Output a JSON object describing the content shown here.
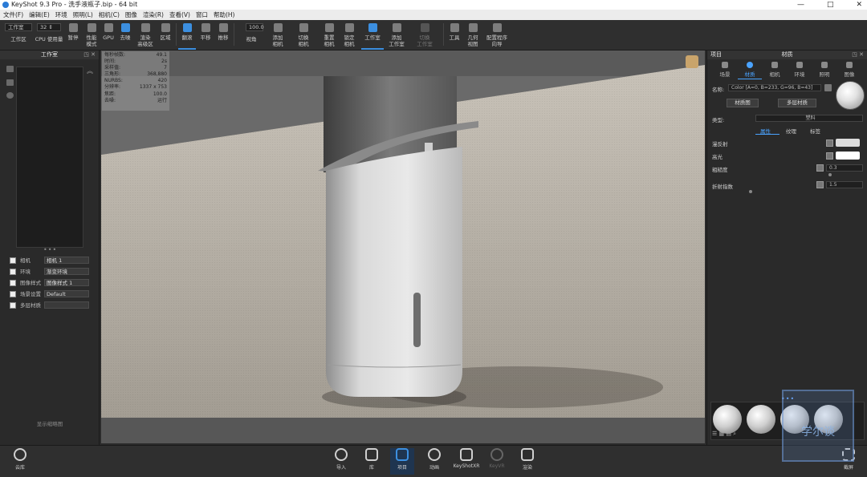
{
  "window": {
    "app_title": "KeyShot 9.3 Pro",
    "file_title": "- 洗手液瓶子.bip - 64 bit",
    "controls": [
      "—",
      "□",
      "✕"
    ]
  },
  "menu": [
    "文件(F)",
    "编辑(E)",
    "环境",
    "照明(L)",
    "相机(C)",
    "图像",
    "渲染(R)",
    "查看(V)",
    "窗口",
    "帮助(H)"
  ],
  "toolbar": {
    "workspace_select": "工作室",
    "cpu_value": "32 ⇕",
    "zoom_value": "100.0",
    "buttons": {
      "workspace": "工作区",
      "cpu_usage": "CPU 使用量",
      "pause": "暂停",
      "performance_mode": "性能\n模式",
      "gpu": "GPU",
      "denoise": "去噪",
      "render_layer": "渲染\n高级区",
      "region": "区域",
      "tumble": "翻滚",
      "pan": "平移",
      "dolly": "推移",
      "perspective": "视角",
      "add_camera": "添加\n相机",
      "switch_camera": "切换\n相机",
      "reset_camera": "重置\n相机",
      "lock_camera": "锁定\n相机",
      "studio": "工作室",
      "add_studio": "添加\n工作室",
      "switch_studio": "切换\n工作室",
      "tools": "工具",
      "geometry_view": "几何\n视图",
      "configurator": "配置程序\n向导"
    }
  },
  "left_panel": {
    "title": "工作室",
    "rows": [
      {
        "label": "相机",
        "value": "相机 1"
      },
      {
        "label": "环境",
        "value": "渐变环境"
      },
      {
        "label": "图像样式",
        "value": "图像样式 1"
      },
      {
        "label": "场景设置",
        "value": "Default"
      },
      {
        "label": "多层材质",
        "value": ""
      }
    ],
    "footer": "显示缩略图"
  },
  "stats": [
    {
      "label": "每秒帧数:",
      "value": "49.1"
    },
    {
      "label": "时间:",
      "value": "2s"
    },
    {
      "label": "采样值:",
      "value": "7"
    },
    {
      "label": "三角形:",
      "value": "368,880"
    },
    {
      "label": "NURBS:",
      "value": "420"
    },
    {
      "label": "分辨率:",
      "value": "1337 x 753"
    },
    {
      "label": "焦距:",
      "value": "100.0"
    },
    {
      "label": "去噪:",
      "value": "运行"
    }
  ],
  "right_panel": {
    "header_left": "项目",
    "header_center": "材质",
    "tabs": [
      "场景",
      "材质",
      "相机",
      "环境",
      "照明",
      "图像"
    ],
    "active_tab": "材质",
    "name_label": "名称:",
    "name_value": "Color [A=0, B=233, G=96, B=43]",
    "material_graph_btn": "材质图",
    "multi_material_btn": "多层材质",
    "type_label": "类型:",
    "type_value": "塑料",
    "sub_tabs": [
      "属性",
      "纹理",
      "标签"
    ],
    "props": [
      {
        "label": "漫反射",
        "value": ""
      },
      {
        "label": "高光",
        "value": ""
      },
      {
        "label": "粗糙度",
        "value": "0.3"
      },
      {
        "label": "折射指数",
        "value": "1.5"
      }
    ],
    "colors": {
      "diffuse": "#dcdcdc",
      "specular": "#ffffff",
      "accent": "#4aa3ff"
    }
  },
  "bottom_bar": {
    "cloud": "云库",
    "items": [
      "导入",
      "库",
      "项目",
      "动画",
      "KeyShotXR",
      "KeyVR",
      "渲染"
    ],
    "active": "项目",
    "screenshot": "截屏"
  },
  "watermark_text": "学尔谈"
}
